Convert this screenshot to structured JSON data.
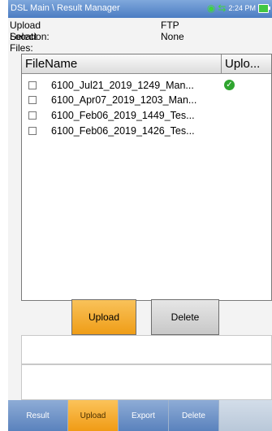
{
  "titlebar": {
    "title": "DSL Main \\ Result Manager",
    "time": "2:24 PM"
  },
  "info": {
    "upload_location_label": "Upload Location:",
    "upload_location_value": "FTP",
    "select_files_label": "Select Files:",
    "select_files_value": "None"
  },
  "grid": {
    "columns": [
      "FileName",
      "Uplo..."
    ],
    "rows": [
      {
        "filename": "6100_Jul21_2019_1249_Man...",
        "uploaded": true
      },
      {
        "filename": "6100_Apr07_2019_1203_Man...",
        "uploaded": false
      },
      {
        "filename": "6100_Feb06_2019_1449_Tes...",
        "uploaded": false
      },
      {
        "filename": "6100_Feb06_2019_1426_Tes...",
        "uploaded": false
      }
    ]
  },
  "buttons": {
    "upload": "Upload",
    "delete": "Delete"
  },
  "tabs": [
    "Result",
    "Upload",
    "Export",
    "Delete",
    ""
  ],
  "colors": {
    "accent": "#f0a020",
    "titlebar": "#5b86c6",
    "tab": "#6f93c8",
    "upload_ok": "#2fa52f"
  },
  "icons": {
    "wifi": "wifi-icon",
    "transfer": "transfer-arrows-icon",
    "battery": "battery-icon",
    "upload_ok": "check-circle-icon"
  }
}
